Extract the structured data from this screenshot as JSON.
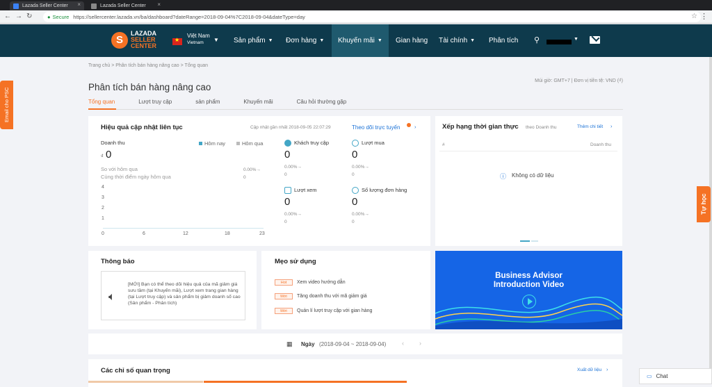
{
  "browser": {
    "tab1": "Lazada Seller Center",
    "tab2": "Lazada Seller Center",
    "secure": "Secure",
    "url": "https://sellercenter.lazada.vn/ba/dashboard?dateRange=2018-09-04%7C2018-09-04&dateType=day"
  },
  "nav": {
    "logo_mark": "S",
    "logo_line1": "LAZADA",
    "logo_line2": "SELLER",
    "logo_line3": "CENTER",
    "country": "Việt Nam",
    "country_sub": "Vietnam",
    "items": [
      {
        "label": "Sản phẩm"
      },
      {
        "label": "Đơn hàng"
      },
      {
        "label": "Khuyến mãi"
      },
      {
        "label": "Gian hàng"
      },
      {
        "label": "Tài chính"
      },
      {
        "label": "Phân tích"
      }
    ]
  },
  "sidetab": "Email cho PSC",
  "tuhoc": "Tự học",
  "breadcrumb": "Trang chủ  >  Phân tích bán hàng nâng cao  >  Tổng quan",
  "timezone": "Múi giờ: GMT+7  |  Đơn vị tiền tệ: VND (₫)",
  "page_title": "Phân tích bán hàng nâng cao",
  "subtabs": [
    "Tổng quan",
    "Lượt truy cập",
    "sản phẩm",
    "Khuyến mãi",
    "Câu hỏi thường gặp"
  ],
  "realtime": {
    "title": "Hiệu quả cập nhật liên tục",
    "updated": "Cập nhật gần nhất 2018-09-05 22:07:29",
    "follow": "Theo dõi trực tuyến",
    "revenue_label": "Doanh thu",
    "currency": "₫",
    "revenue": "0",
    "legend_today": "Hôm nay",
    "legend_yesterday": "Hôm qua",
    "cmp1": "So với hôm qua",
    "cmp2": "Cùng thời điểm ngày hôm qua",
    "cmp_pct": "0.00%→",
    "cmp_val": "0",
    "y_ticks": [
      "4",
      "3",
      "2",
      "1"
    ],
    "x_ticks": [
      "0",
      "6",
      "12",
      "18",
      "23"
    ],
    "metrics": [
      {
        "label": "Khách truy cập",
        "value": "0",
        "pct": "0.00%→",
        "sub": "0"
      },
      {
        "label": "Lượt mua",
        "value": "0",
        "pct": "0.00%→",
        "sub": "0"
      },
      {
        "label": "Lượt xem",
        "value": "0",
        "pct": "0.00%→",
        "sub": "0"
      },
      {
        "label": "Số lượng đơn hàng",
        "value": "0",
        "pct": "0.00%→",
        "sub": "0"
      }
    ]
  },
  "ranking": {
    "title": "Xếp hạng thời gian thực",
    "by": "theo Doanh thu",
    "more": "Thêm chi tiết",
    "col_hash": "#",
    "col_rev": "Doanh thu",
    "empty": "Không có dữ liệu"
  },
  "notice": {
    "title": "Thông báo",
    "text": "[MỚI] Bạn có thể theo dõi hiệu quả của mã giảm giá sưu tầm (tại Khuyến mãi), Lượt xem trang gian hàng (tại Lượt truy cập) và sản phẩm bị giảm doanh số cao (Sản phẩm - Phân tích)"
  },
  "tips": {
    "title": "Mẹo sử dụng",
    "items": [
      {
        "badge": "Hot",
        "text": "Xem video hướng dẫn"
      },
      {
        "badge": "Mới",
        "text": "Tăng doanh thu với mã giảm giá"
      },
      {
        "badge": "Mới",
        "text": "Quản lí lượt truy cập với gian hàng"
      }
    ]
  },
  "video": {
    "line1": "Business Advisor",
    "line2": "Introduction Video"
  },
  "datebar": {
    "label": "Ngày",
    "range": "(2018-09-04 ~ 2018-09-04)"
  },
  "key": {
    "title": "Các chỉ số quan trọng",
    "export": "Xuất dữ liệu"
  },
  "chat": "Chat",
  "colors": {
    "accent": "#f57224",
    "nav": "#0e3a4c",
    "teal": "#43a6c6"
  }
}
